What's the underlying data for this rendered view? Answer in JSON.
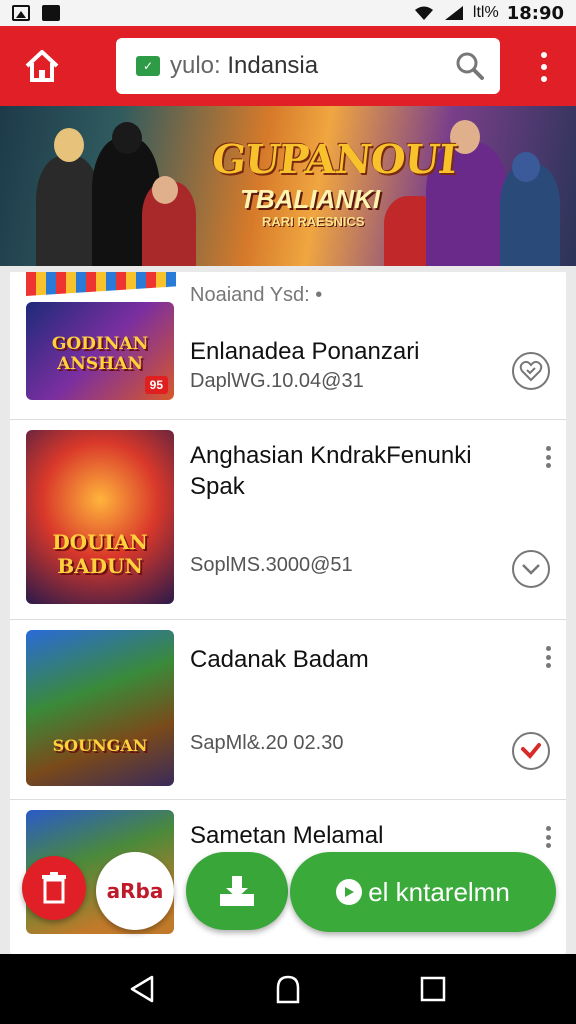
{
  "status_bar": {
    "battery_text": "ltl%",
    "time": "18:90"
  },
  "toolbar": {
    "search_prefix": "yulo: ",
    "search_query": "Indansia"
  },
  "banner": {
    "title_line1": "GUPANOUI",
    "title_line2": "TBALIANKI",
    "title_line3": "RARI RAESNICS"
  },
  "list": {
    "section_label": "Noaiand Ysd: •",
    "items": [
      {
        "title": "Enlanadea Ponanzari",
        "subtitle": "DaplWG.10.04@31",
        "thumb_text": "GODINAN ANSHAN",
        "thumb_badge": "95",
        "status": "heart-check"
      },
      {
        "title": "Anghasian KndrakFenunki Spak",
        "subtitle": "SoplMS.3000@51",
        "thumb_text": "DOUIAN BADUN",
        "status": "chevron-check"
      },
      {
        "title": "Cadanak Badam",
        "subtitle": "SapMl&.20 02.30",
        "thumb_text": "SOUNGAN",
        "status": "red-check"
      },
      {
        "title": "Sametan Melamal",
        "thumb_text": ""
      }
    ]
  },
  "fabs": {
    "white_label": "aRba",
    "wide_label": "el kntarelmn"
  },
  "colors": {
    "toolbar": "#e01f26",
    "fab_green": "#3aaa3b",
    "check_red": "#d92a2a"
  }
}
